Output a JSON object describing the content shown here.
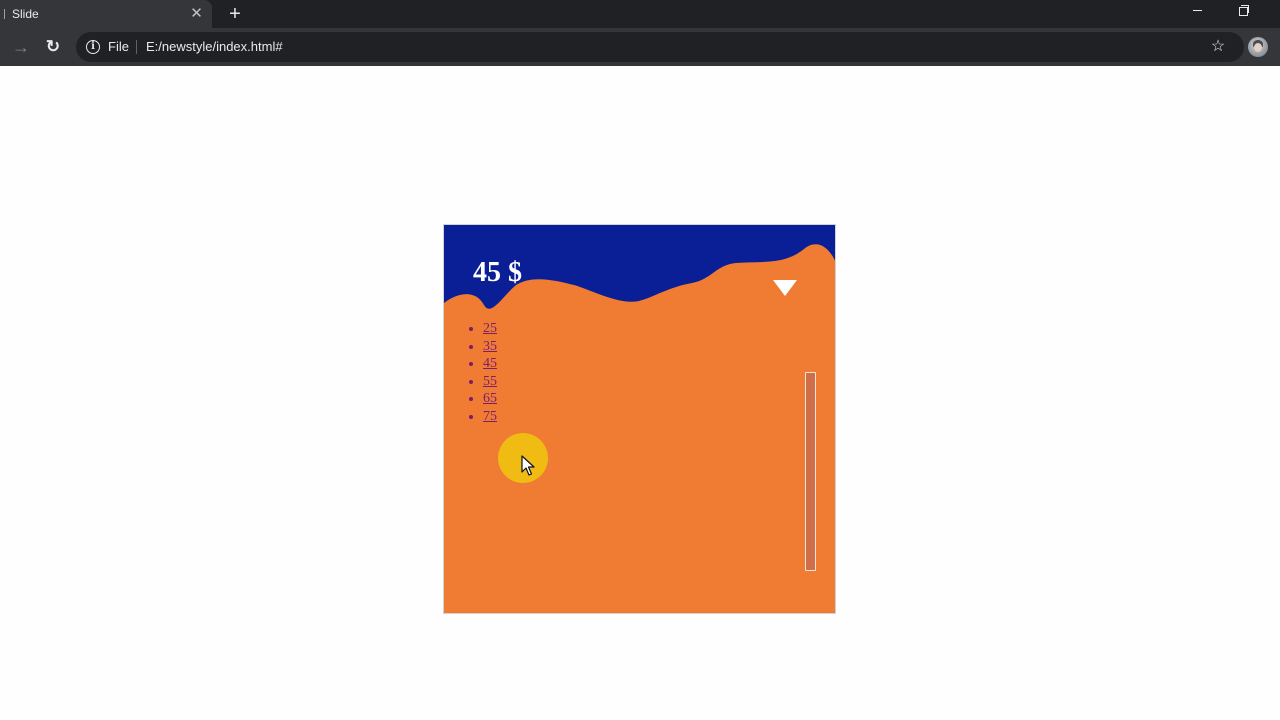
{
  "browser": {
    "tab": {
      "title": "Slide",
      "close_glyph": "✕"
    },
    "new_tab_glyph": "+",
    "window_controls": [
      "minimize",
      "restore"
    ],
    "toolbar": {
      "forward_glyph": "→",
      "reload_glyph": "↻",
      "info_glyph": "i",
      "scheme_label": "File",
      "url": "E:/newstyle/index.html#",
      "bookmark_glyph": "☆"
    }
  },
  "slide": {
    "colors": {
      "header": "#0a1f96",
      "body": "#f07b33",
      "cursor_highlight": "#f0c010",
      "link": "#7b1e6e"
    },
    "price": "45 $",
    "options": [
      "25",
      "35",
      "45",
      "55",
      "65",
      "75"
    ],
    "slider": {
      "orientation": "vertical"
    },
    "icons": {
      "dropdown": "triangle-down-icon",
      "pointer": "mouse-pointer-icon"
    }
  }
}
